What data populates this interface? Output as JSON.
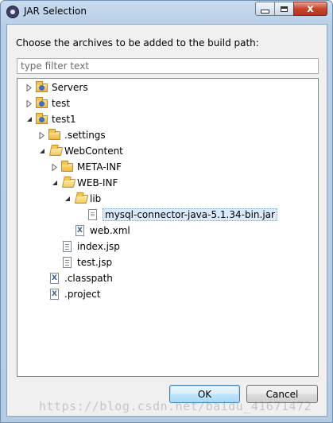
{
  "window": {
    "title": "JAR Selection",
    "close_glyph": "x"
  },
  "dialog": {
    "prompt": "Choose the archives to be added to the build path:",
    "filter_placeholder": "type filter text",
    "filter_value": ""
  },
  "tree": [
    {
      "label": "Servers",
      "icon": "project-folder-icon",
      "expander": "collapsed",
      "depth": 0
    },
    {
      "label": "test",
      "icon": "project-folder-icon",
      "expander": "collapsed",
      "depth": 0
    },
    {
      "label": "test1",
      "icon": "project-folder-icon",
      "expander": "expanded",
      "depth": 0
    },
    {
      "label": ".settings",
      "icon": "folder-icon",
      "expander": "collapsed",
      "depth": 1
    },
    {
      "label": "WebContent",
      "icon": "folder-open-icon",
      "expander": "expanded",
      "depth": 1
    },
    {
      "label": "META-INF",
      "icon": "folder-icon",
      "expander": "collapsed",
      "depth": 2
    },
    {
      "label": "WEB-INF",
      "icon": "folder-open-icon",
      "expander": "expanded",
      "depth": 2
    },
    {
      "label": "lib",
      "icon": "folder-open-icon",
      "expander": "expanded",
      "depth": 3
    },
    {
      "label": "mysql-connector-java-5.1.34-bin.jar",
      "icon": "jar-file-icon",
      "expander": "none",
      "depth": 4,
      "selected": true
    },
    {
      "label": "web.xml",
      "icon": "xml-file-icon",
      "expander": "none",
      "depth": 3
    },
    {
      "label": "index.jsp",
      "icon": "jsp-file-icon",
      "expander": "none",
      "depth": 2
    },
    {
      "label": "test.jsp",
      "icon": "jsp-file-icon",
      "expander": "none",
      "depth": 2
    },
    {
      "label": ".classpath",
      "icon": "xml-file-icon",
      "expander": "none",
      "depth": 1
    },
    {
      "label": ".project",
      "icon": "xml-file-icon",
      "expander": "none",
      "depth": 1
    }
  ],
  "buttons": {
    "ok": "OK",
    "cancel": "Cancel"
  },
  "watermark": "https://blog.csdn.net/baidu_41671472",
  "colors": {
    "selection": "#dcebfc",
    "title_gradient": "#c9dcef",
    "close_button": "#c7442a"
  }
}
